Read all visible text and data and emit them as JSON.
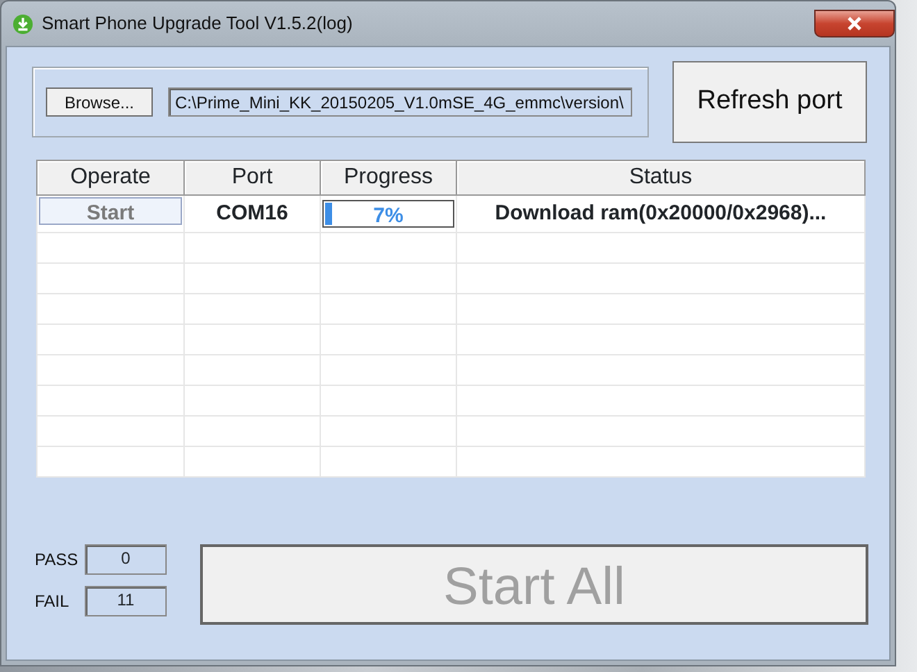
{
  "window": {
    "title": "Smart Phone Upgrade Tool V1.5.2(log)"
  },
  "file": {
    "button": "Browse...",
    "path": "C:\\Prime_Mini_KK_20150205_V1.0mSE_4G_emmc\\version\\"
  },
  "refresh_button": "Refresh port",
  "table": {
    "columns": [
      "Operate",
      "Port",
      "Progress",
      "Status"
    ],
    "rows": [
      {
        "operate": {
          "label": "Start",
          "disabled": true
        },
        "port": "COM16",
        "progress": {
          "level": 0.07,
          "reading": "7%"
        },
        "status": "Download ram(0x20000/0x2968)..."
      }
    ]
  },
  "counters": [
    {
      "label": "PASS",
      "value": "0"
    },
    {
      "label": "FAIL",
      "value": "11"
    }
  ],
  "start_all": {
    "label": "Start All",
    "disabled": true
  }
}
